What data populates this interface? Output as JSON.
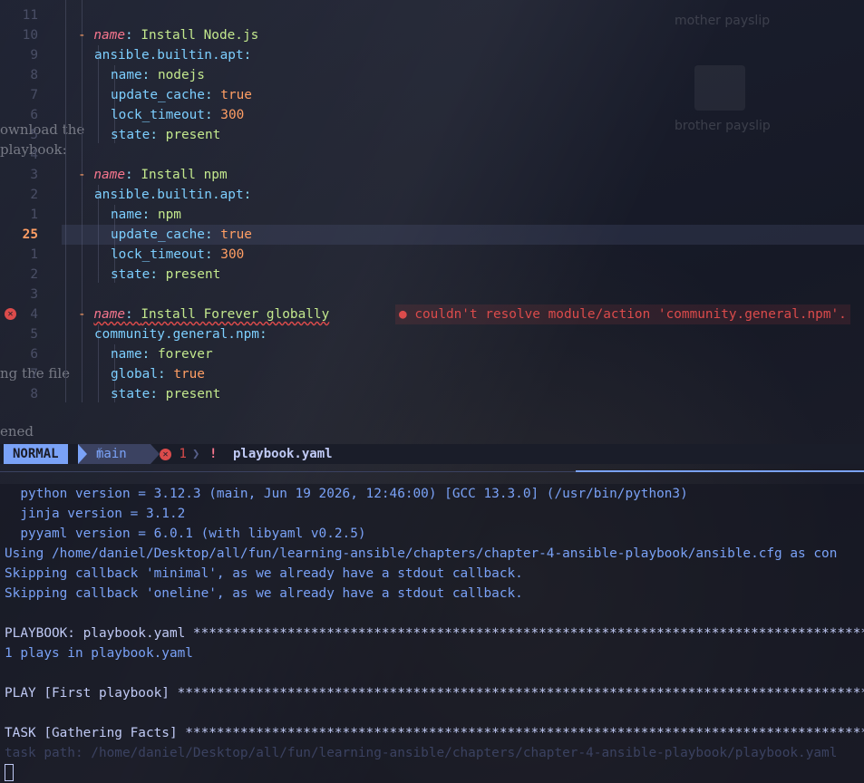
{
  "editor": {
    "lines": [
      {
        "num": "11",
        "parts": []
      },
      {
        "num": "10",
        "parts": [
          [
            "dash",
            "- "
          ],
          [
            "nm",
            "name"
          ],
          [
            "punc",
            ": "
          ],
          [
            "str",
            "Install Node.js"
          ]
        ]
      },
      {
        "num": "9",
        "parts": [
          [
            "mod",
            "ansible.builtin.apt"
          ],
          [
            "punc",
            ":"
          ]
        ]
      },
      {
        "num": "8",
        "parts": [
          [
            "key",
            "name"
          ],
          [
            "punc",
            ": "
          ],
          [
            "str",
            "nodejs"
          ]
        ]
      },
      {
        "num": "7",
        "parts": [
          [
            "key",
            "update_cache"
          ],
          [
            "punc",
            ": "
          ],
          [
            "bool",
            "true"
          ]
        ]
      },
      {
        "num": "6",
        "parts": [
          [
            "key",
            "lock_timeout"
          ],
          [
            "punc",
            ": "
          ],
          [
            "num",
            "300"
          ]
        ]
      },
      {
        "num": "5",
        "parts": [
          [
            "key",
            "state"
          ],
          [
            "punc",
            ": "
          ],
          [
            "str",
            "present"
          ]
        ]
      },
      {
        "num": "4",
        "parts": []
      },
      {
        "num": "3",
        "parts": [
          [
            "dash",
            "- "
          ],
          [
            "nm",
            "name"
          ],
          [
            "punc",
            ": "
          ],
          [
            "str",
            "Install npm"
          ]
        ]
      },
      {
        "num": "2",
        "parts": [
          [
            "mod",
            "ansible.builtin.apt"
          ],
          [
            "punc",
            ":"
          ]
        ]
      },
      {
        "num": "1",
        "parts": [
          [
            "key",
            "name"
          ],
          [
            "punc",
            ": "
          ],
          [
            "str",
            "npm"
          ]
        ]
      },
      {
        "num": "25",
        "parts": [
          [
            "key",
            "update_cache"
          ],
          [
            "punc",
            ": "
          ],
          [
            "bool",
            "true"
          ]
        ]
      },
      {
        "num": "1",
        "parts": [
          [
            "key",
            "lock_timeout"
          ],
          [
            "punc",
            ": "
          ],
          [
            "num",
            "300"
          ]
        ]
      },
      {
        "num": "2",
        "parts": [
          [
            "key",
            "state"
          ],
          [
            "punc",
            ": "
          ],
          [
            "str",
            "present"
          ]
        ]
      },
      {
        "num": "3",
        "parts": []
      },
      {
        "num": "4",
        "parts": [
          [
            "dash",
            "- "
          ],
          [
            "nm",
            "name"
          ],
          [
            "punc",
            ": "
          ],
          [
            "str",
            "Install Forever globally"
          ]
        ]
      },
      {
        "num": "5",
        "parts": [
          [
            "mod",
            "community.general.npm"
          ],
          [
            "punc",
            ":"
          ]
        ]
      },
      {
        "num": "6",
        "parts": [
          [
            "key",
            "name"
          ],
          [
            "punc",
            ": "
          ],
          [
            "str",
            "forever"
          ]
        ]
      },
      {
        "num": "7",
        "parts": [
          [
            "key",
            "global"
          ],
          [
            "punc",
            ": "
          ],
          [
            "bool",
            "true"
          ]
        ]
      },
      {
        "num": "8",
        "parts": [
          [
            "key",
            "state"
          ],
          [
            "punc",
            ": "
          ],
          [
            "str",
            "present"
          ]
        ]
      }
    ],
    "diagnostic_sign": "✕",
    "diagnostic_message": "● couldn't resolve module/action 'community.general.npm'."
  },
  "statusline": {
    "mode": "NORMAL",
    "branch_icon": "ᚴ",
    "branch": "main",
    "error_count": "1",
    "error_icon": "✕",
    "modified_flag": "!",
    "filename": "playbook.yaml"
  },
  "terminal": {
    "lines": [
      "  python version = 3.12.3 (main, Jun 19 2026, 12:46:00) [GCC 13.3.0] (/usr/bin/python3)",
      "  jinja version = 3.1.2",
      "  pyyaml version = 6.0.1 (with libyaml v0.2.5)",
      "Using /home/daniel/Desktop/all/fun/learning-ansible/chapters/chapter-4-ansible-playbook/ansible.cfg as con",
      "Skipping callback 'minimal', as we already have a stdout callback.",
      "Skipping callback 'oneline', as we already have a stdout callback.",
      "",
      "PLAYBOOK: playbook.yaml ****************************************************************************************",
      "1 plays in playbook.yaml",
      "",
      "PLAY [First playbook] ******************************************************************************************",
      "",
      "TASK [Gathering Facts] *****************************************************************************************",
      "task path: /home/daniel/Desktop/all/fun/learning-ansible/chapters/chapter-4-ansible-playbook/playbook.yaml"
    ]
  },
  "background": {
    "desktop_labels": [
      "mother payslip",
      "brother payslip"
    ],
    "ghost_texts": [
      "ownload the",
      "playbook:",
      "ng the file",
      "ened"
    ]
  }
}
